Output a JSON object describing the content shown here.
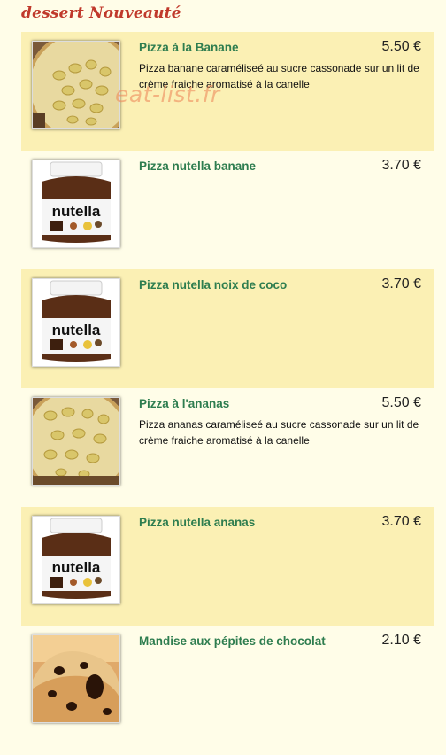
{
  "section": {
    "title": "dessert Nouveauté"
  },
  "watermark": "eat-list.fr",
  "items": [
    {
      "name": "Pizza à la Banane",
      "price": "5.50 €",
      "description": "Pizza banane caraméliseé au sucre cassonade sur un lit de crème fraiche aromatisé à la canelle",
      "image": "banana-pizza"
    },
    {
      "name": "Pizza nutella banane",
      "price": "3.70 €",
      "description": "",
      "image": "nutella-jar"
    },
    {
      "name": "Pizza nutella noix de coco",
      "price": "3.70 €",
      "description": "",
      "image": "nutella-jar"
    },
    {
      "name": "Pizza à l'ananas",
      "price": "5.50 €",
      "description": "Pizza ananas caraméliseé au sucre cassonade sur un lit de crème fraiche aromatisé à la canelle",
      "image": "banana-pizza"
    },
    {
      "name": "Pizza nutella ananas",
      "price": "3.70 €",
      "description": "",
      "image": "nutella-jar"
    },
    {
      "name": "Mandise aux pépites de chocolat",
      "price": "2.10 €",
      "description": "",
      "image": "chocolate-chip-muffin"
    }
  ],
  "nutella_label": "nutella"
}
